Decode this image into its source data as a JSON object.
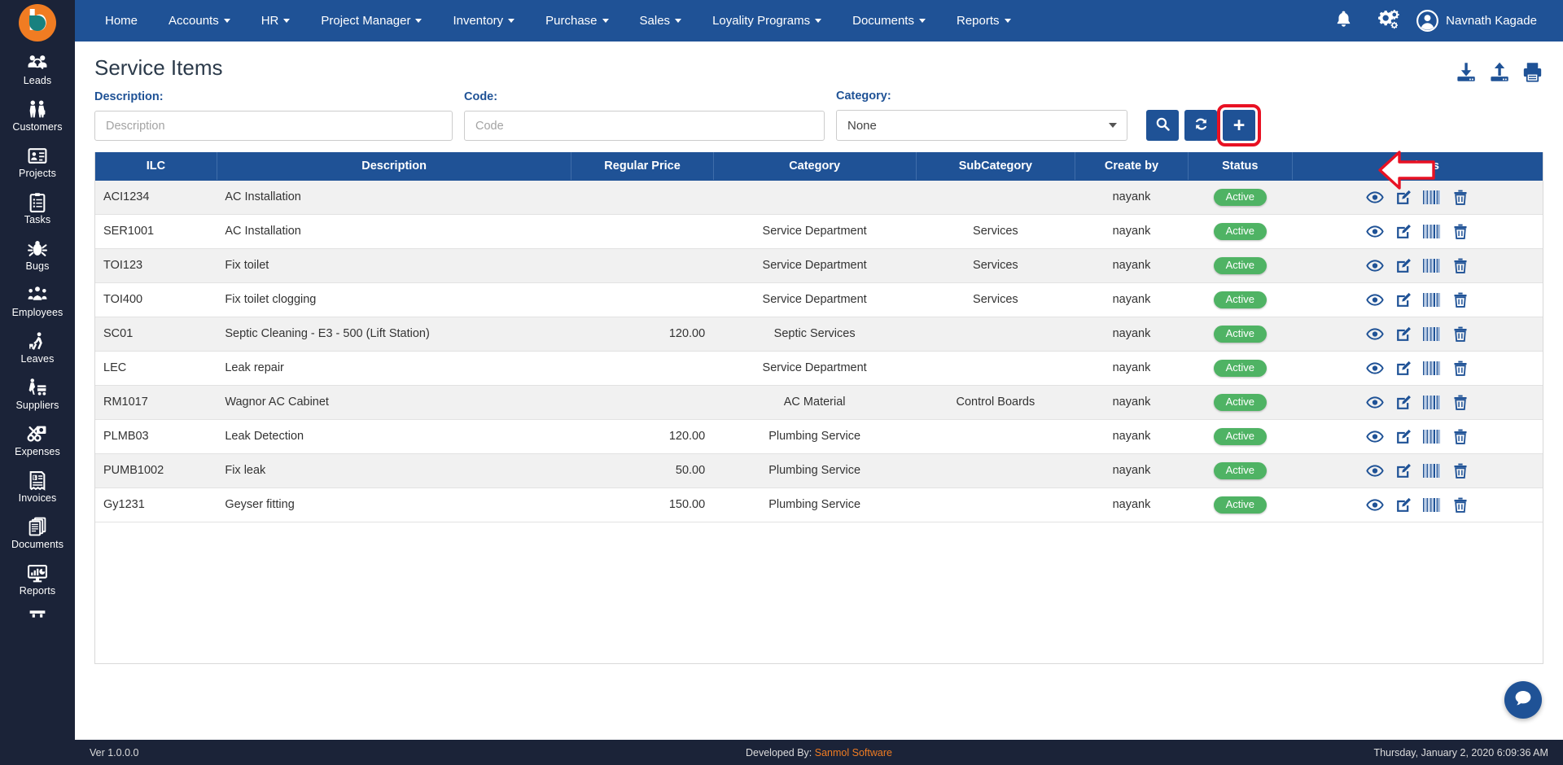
{
  "brand": {
    "logo_letter": "b"
  },
  "sidebar": {
    "items": [
      {
        "label": "Leads",
        "icon": "leads-icon"
      },
      {
        "label": "Customers",
        "icon": "customers-icon"
      },
      {
        "label": "Projects",
        "icon": "projects-icon"
      },
      {
        "label": "Tasks",
        "icon": "tasks-icon"
      },
      {
        "label": "Bugs",
        "icon": "bugs-icon"
      },
      {
        "label": "Employees",
        "icon": "employees-icon"
      },
      {
        "label": "Leaves",
        "icon": "leaves-icon"
      },
      {
        "label": "Suppliers",
        "icon": "suppliers-icon"
      },
      {
        "label": "Expenses",
        "icon": "expenses-icon"
      },
      {
        "label": "Invoices",
        "icon": "invoices-icon"
      },
      {
        "label": "Documents",
        "icon": "documents-icon"
      },
      {
        "label": "Reports",
        "icon": "reports-icon"
      }
    ]
  },
  "topnav": {
    "items": [
      {
        "label": "Home",
        "has_caret": false
      },
      {
        "label": "Accounts",
        "has_caret": true
      },
      {
        "label": "HR",
        "has_caret": true
      },
      {
        "label": "Project Manager",
        "has_caret": true
      },
      {
        "label": "Inventory",
        "has_caret": true
      },
      {
        "label": "Purchase",
        "has_caret": true
      },
      {
        "label": "Sales",
        "has_caret": true
      },
      {
        "label": "Loyality Programs",
        "has_caret": true
      },
      {
        "label": "Documents",
        "has_caret": true
      },
      {
        "label": "Reports",
        "has_caret": true
      }
    ],
    "user_name": "Navnath Kagade",
    "notification_icon": "bell-icon",
    "settings_icon": "gears-icon",
    "avatar_icon": "user-avatar-icon"
  },
  "page": {
    "title": "Service Items",
    "tools": [
      "download-icon",
      "upload-icon",
      "print-icon"
    ]
  },
  "filters": {
    "description_label": "Description:",
    "description_placeholder": "Description",
    "description_value": "",
    "code_label": "Code:",
    "code_placeholder": "Code",
    "code_value": "",
    "category_label": "Category:",
    "category_value": "None",
    "category_options": [
      "None"
    ],
    "search_button": "search-icon",
    "refresh_button": "refresh-icon",
    "add_button": "+"
  },
  "table": {
    "columns": [
      "ILC",
      "Description",
      "Regular Price",
      "Category",
      "SubCategory",
      "Create by",
      "Status",
      "Actions"
    ],
    "rows": [
      {
        "ilc": "ACI1234",
        "description": "AC Installation",
        "price": "",
        "category": "",
        "subcategory": "",
        "created_by": "nayank",
        "status": "Active"
      },
      {
        "ilc": "SER1001",
        "description": "AC Installation",
        "price": "",
        "category": "Service Department",
        "subcategory": "Services",
        "created_by": "nayank",
        "status": "Active"
      },
      {
        "ilc": "TOI123",
        "description": "Fix toilet",
        "price": "",
        "category": "Service Department",
        "subcategory": "Services",
        "created_by": "nayank",
        "status": "Active"
      },
      {
        "ilc": "TOI400",
        "description": "Fix toilet clogging",
        "price": "",
        "category": "Service Department",
        "subcategory": "Services",
        "created_by": "nayank",
        "status": "Active"
      },
      {
        "ilc": "SC01",
        "description": "Septic Cleaning - E3 - 500 (Lift Station)",
        "price": "120.00",
        "category": "Septic Services",
        "subcategory": "",
        "created_by": "nayank",
        "status": "Active"
      },
      {
        "ilc": "LEC",
        "description": "Leak repair",
        "price": "",
        "category": "Service Department",
        "subcategory": "",
        "created_by": "nayank",
        "status": "Active"
      },
      {
        "ilc": "RM1017",
        "description": "Wagnor AC Cabinet",
        "price": "",
        "category": "AC Material",
        "subcategory": "Control Boards",
        "created_by": "nayank",
        "status": "Active"
      },
      {
        "ilc": "PLMB03",
        "description": "Leak Detection",
        "price": "120.00",
        "category": "Plumbing Service",
        "subcategory": "",
        "created_by": "nayank",
        "status": "Active"
      },
      {
        "ilc": "PUMB1002",
        "description": "Fix leak",
        "price": "50.00",
        "category": "Plumbing Service",
        "subcategory": "",
        "created_by": "nayank",
        "status": "Active"
      },
      {
        "ilc": "Gy1231",
        "description": "Geyser fitting",
        "price": "150.00",
        "category": "Plumbing Service",
        "subcategory": "",
        "created_by": "nayank",
        "status": "Active"
      }
    ],
    "row_actions": [
      "view-icon",
      "edit-icon",
      "barcode-icon",
      "delete-icon"
    ]
  },
  "chat": {
    "icon": "chat-icon"
  },
  "footer": {
    "version": "Ver 1.0.0.0",
    "developed_by_prefix": "Developed By: ",
    "developed_by_company": "Sanmol Software",
    "timestamp": "Thursday, January 2, 2020 6:09:36 AM"
  },
  "colors": {
    "primary": "#1f5296",
    "sidebar": "#1b2338",
    "accent_orange": "#f07c22",
    "status_green": "#4fb364",
    "highlight_red": "#e81123"
  }
}
